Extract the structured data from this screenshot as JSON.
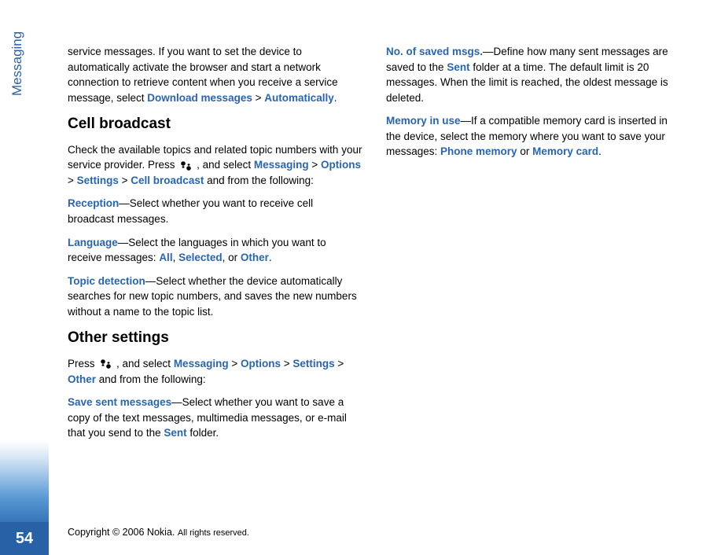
{
  "sidebar": {
    "label": "Messaging",
    "page_number": "54"
  },
  "col1": {
    "p1_a": "service messages. If you want to set the device to automatically activate the browser and start a network connection to retrieve content when you receive a service message, select ",
    "p1_link1": "Download messages",
    "p1_gt1": " > ",
    "p1_link2": "Automatically",
    "p1_end": ".",
    "h1": "Cell broadcast",
    "p2_a": "Check the available topics and related topic numbers with your service provider. Press ",
    "p2_b": " , and select ",
    "p2_link1": "Messaging",
    "p2_gt1": " > ",
    "p2_link2": "Options",
    "p2_gt2": " > ",
    "p2_link3": "Settings",
    "p2_gt3": " > ",
    "p2_link4": "Cell broadcast",
    "p2_c": " and from the following:",
    "p3_term": "Reception",
    "p3_a": "—Select whether you want to receive cell broadcast messages.",
    "p4_term": "Language",
    "p4_a": "—Select the languages in which you want to receive messages: ",
    "p4_link1": "All",
    "p4_sep1": ", ",
    "p4_link2": "Selected",
    "p4_sep2": ", or ",
    "p4_link3": "Other",
    "p4_end": ".",
    "p5_term": "Topic detection",
    "p5_a": "—Select whether the device automatically searches for new topic numbers, and saves the new numbers without a name to the topic list.",
    "h2": "Other settings",
    "p6_a": "Press ",
    "p6_b": " , and select ",
    "p6_link1": "Messaging",
    "p6_gt1": " > ",
    "p6_link2": "Options",
    "p6_gt2": " > ",
    "p6_link3": "Settings",
    "p6_gt3": " > ",
    "p6_link4": "Other",
    "p6_c": " and from the following:",
    "p7_term": "Save sent messages",
    "p7_a": "—Select whether you want to save a copy of the text messages, multimedia messages, or e-mail that you send to the ",
    "p7_link1": "Sent",
    "p7_b": " folder."
  },
  "col2": {
    "p1_term": "No. of saved msgs.",
    "p1_a": "—Define how many sent messages are saved to the ",
    "p1_link1": "Sent",
    "p1_b": " folder at a time. The default limit is 20 messages. When the limit is reached, the oldest message is deleted.",
    "p2_term": "Memory in use",
    "p2_a": "—If a compatible memory card is inserted in the device, select the memory where you want to save your messages: ",
    "p2_link1": "Phone memory",
    "p2_sep": " or ",
    "p2_link2": "Memory card",
    "p2_end": "."
  },
  "footer": {
    "copyright": "Copyright © 2006 Nokia. ",
    "rights": "All rights reserved."
  }
}
